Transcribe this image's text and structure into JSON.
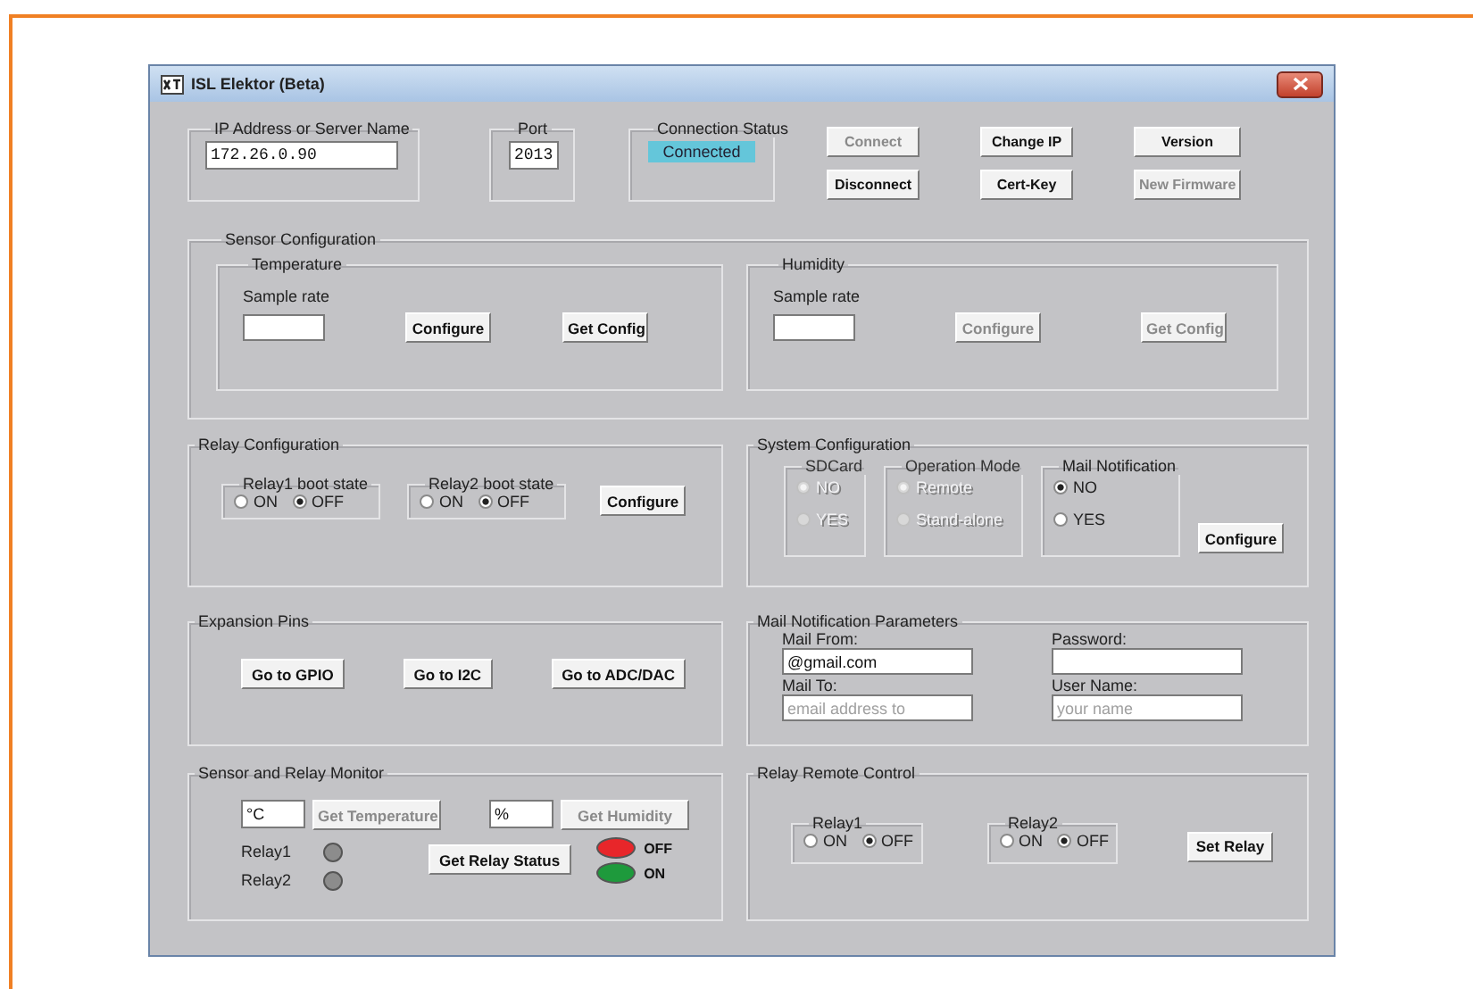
{
  "window": {
    "title": "ISL Elektor (Beta)"
  },
  "connection": {
    "ip_label": "IP Address or Server Name",
    "ip": "172.26.0.90",
    "port_label": "Port",
    "port": "2013",
    "status_label": "Connection Status",
    "status": "Connected"
  },
  "buttons": [
    {
      "label": "Connect",
      "disabled": true
    },
    {
      "label": "Change IP",
      "disabled": false
    },
    {
      "label": "Version",
      "disabled": false
    },
    {
      "label": "Disconnect",
      "disabled": false
    },
    {
      "label": "Cert-Key",
      "disabled": false
    },
    {
      "label": "New Firmware",
      "disabled": true
    }
  ],
  "sensor_configuration": {
    "title": "Sensor Configuration",
    "groups": [
      {
        "title": "Temperature",
        "sample_label": "Sample rate",
        "buttons": [
          {
            "label": "Configure",
            "disabled": false
          },
          {
            "label": "Get Config",
            "disabled": false
          }
        ]
      },
      {
        "title": "Humidity",
        "sample_label": "Sample rate",
        "buttons": [
          {
            "label": "Configure",
            "disabled": true
          },
          {
            "label": "Get Config",
            "disabled": true
          }
        ]
      }
    ]
  },
  "relay_configuration": {
    "title": "Relay Configuration",
    "relays": [
      {
        "title": "Relay1 boot state",
        "options": [
          {
            "label": "ON",
            "selected": false
          },
          {
            "label": "OFF",
            "selected": true
          }
        ]
      },
      {
        "title": "Relay2 boot state",
        "options": [
          {
            "label": "ON",
            "selected": false
          },
          {
            "label": "OFF",
            "selected": true
          }
        ]
      }
    ],
    "button": {
      "label": "Configure",
      "disabled": false
    }
  },
  "system_configuration": {
    "title": "System Configuration",
    "groups": [
      {
        "title": "SDCard",
        "disabled": true,
        "options": [
          {
            "label": "NO",
            "selected": true
          },
          {
            "label": "YES",
            "selected": false
          }
        ]
      },
      {
        "title": "Operation Mode",
        "disabled": true,
        "options": [
          {
            "label": "Remote",
            "selected": true
          },
          {
            "label": "Stand-alone",
            "selected": false
          }
        ]
      },
      {
        "title": "Mail Notification",
        "disabled": false,
        "options": [
          {
            "label": "NO",
            "selected": true
          },
          {
            "label": "YES",
            "selected": false
          }
        ]
      }
    ],
    "button": {
      "label": "Configure",
      "disabled": false
    }
  },
  "expansion_pins": {
    "title": "Expansion Pins",
    "buttons": [
      {
        "label": "Go to GPIO",
        "disabled": false
      },
      {
        "label": "Go to I2C",
        "disabled": false
      },
      {
        "label": "Go to ADC/DAC",
        "disabled": false
      }
    ]
  },
  "mail_parameters": {
    "title": "Mail Notification Parameters",
    "fields": [
      {
        "label": "Mail From:",
        "value": "@gmail.com"
      },
      {
        "label": "Password:"
      },
      {
        "label": "Mail To:",
        "placeholder": "email address to"
      },
      {
        "label": "User Name:",
        "placeholder": "your name"
      }
    ]
  },
  "monitor": {
    "title": "Sensor and Relay Monitor",
    "readings": [
      {
        "value": "°C",
        "button": {
          "label": "Get Temperature",
          "disabled": true
        }
      },
      {
        "value": "%",
        "button": {
          "label": "Get Humidity",
          "disabled": true
        }
      }
    ],
    "relays": [
      {
        "label": "Relay1",
        "color": "#8c8c8c"
      },
      {
        "label": "Relay2",
        "color": "#8c8c8c"
      }
    ],
    "status_button": {
      "label": "Get Relay Status",
      "disabled": false
    },
    "legend": [
      {
        "label": "OFF",
        "color": "#e8262a"
      },
      {
        "label": "ON",
        "color": "#1e9a3c"
      }
    ]
  },
  "remote_control": {
    "title": "Relay Remote Control",
    "relays": [
      {
        "title": "Relay1",
        "options": [
          {
            "label": "ON",
            "selected": false
          },
          {
            "label": "OFF",
            "selected": true
          }
        ]
      },
      {
        "title": "Relay2",
        "options": [
          {
            "label": "ON",
            "selected": false
          },
          {
            "label": "OFF",
            "selected": true
          }
        ]
      }
    ],
    "button": {
      "label": "Set Relay",
      "disabled": false
    }
  }
}
